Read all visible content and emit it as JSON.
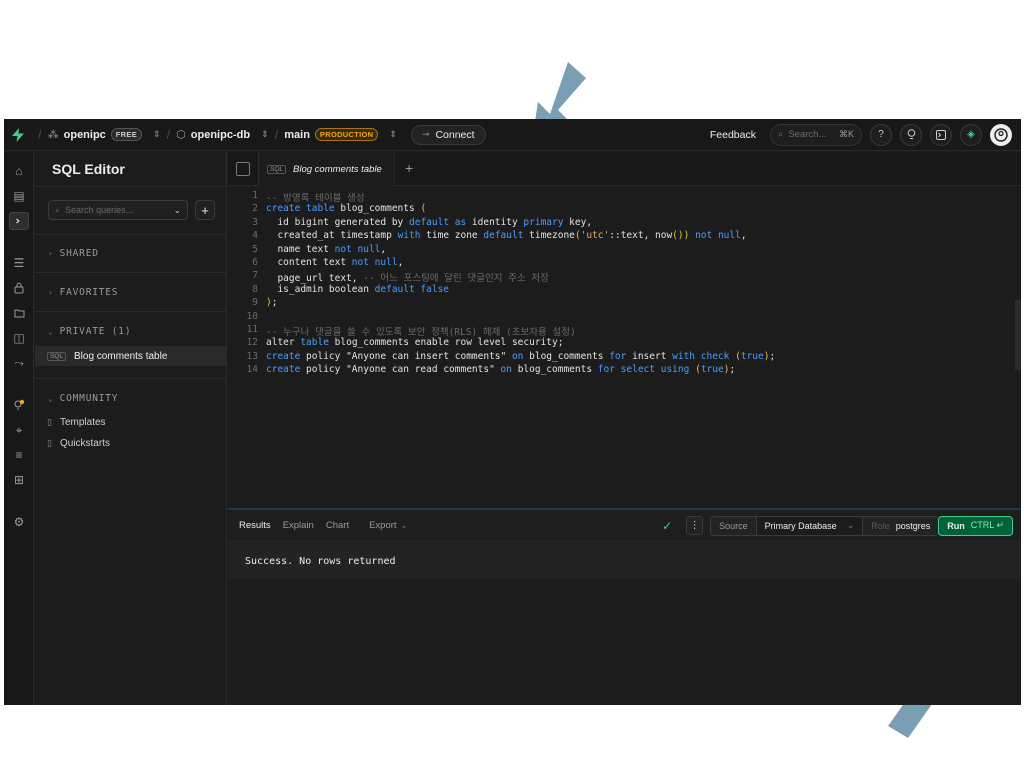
{
  "topbar": {
    "org_name": "openipc",
    "org_badge": "FREE",
    "project_name": "openipc-db",
    "branch_name": "main",
    "branch_badge": "PRODUCTION",
    "connect_label": "Connect",
    "feedback_label": "Feedback",
    "search_placeholder": "Search...",
    "search_shortcut": "⌘K"
  },
  "sidebar": {
    "title": "SQL Editor",
    "search_placeholder": "Search queries...",
    "sections": {
      "shared": "SHARED",
      "favorites": "FAVORITES",
      "private": "PRIVATE (1)",
      "community": "COMMUNITY"
    },
    "private_items": [
      "Blog comments table"
    ],
    "community_items": [
      "Templates",
      "Quickstarts"
    ]
  },
  "tabs": {
    "active_label": "Blog comments table",
    "chip": "SQL"
  },
  "editor": {
    "line_numbers": [
      "1",
      "2",
      "3",
      "4",
      "5",
      "6",
      "7",
      "8",
      "9",
      "10",
      "11",
      "12",
      "13",
      "14"
    ]
  },
  "results": {
    "tabs": [
      "Results",
      "Explain",
      "Chart",
      "Export"
    ],
    "source_label": "Source",
    "source_value": "Primary Database",
    "role_label": "Role",
    "role_value": "postgres",
    "run_label": "Run",
    "run_shortcut": "CTRL ↵",
    "message": "Success. No rows returned"
  },
  "colors": {
    "brand_green": "#3ecf8e",
    "keyword_blue": "#4a9eff",
    "production_orange": "#f5a524",
    "arrow_blue": "#7a9fb5"
  }
}
